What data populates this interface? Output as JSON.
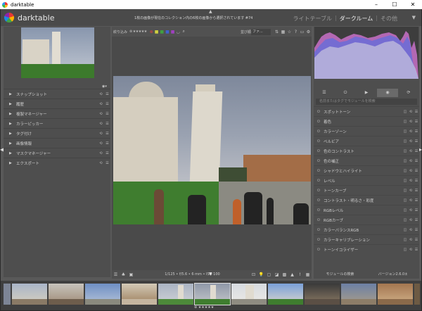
{
  "titlebar": {
    "title": "darktable",
    "min": "–",
    "max": "☐",
    "close": "✕"
  },
  "header": {
    "app_name": "darktable",
    "message": "1枚の画像が現在のコレクション内の6枚の画像から選択されています #74",
    "views": [
      "ライトテーブル",
      "ダークルーム",
      "その他"
    ],
    "active_view": "ダークルーム",
    "menu": "▼"
  },
  "left_modules": [
    "スナップショット",
    "履歴",
    "複製マネージャー",
    "カラーピッカー",
    "タグ付け",
    "画像情報",
    "マスクマネージャー",
    "エクスポート"
  ],
  "top_toolbar": {
    "filter_label": "絞り込み",
    "stars": "⊗ ★★★★★",
    "color_labels": [
      "#d64040",
      "#d0d040",
      "#40a040",
      "#4060d0",
      "#a040c0"
    ],
    "sort_label": "並び順",
    "sort_value": "ファ..."
  },
  "photo_info": "1/125 • f/5.6 • 6 mm • ISO 100",
  "right_tabs": [
    "☰",
    "⏻",
    "▶",
    "◉",
    "⟳"
  ],
  "search_placeholder": "名前またはタグでモジュールを検索",
  "right_modules": [
    "スポットトーン",
    "着色",
    "カラーゾーン",
    "ベルビア",
    "色のコントラスト",
    "色の補正",
    "シャドウとハイライト",
    "レベル",
    "トーンカーブ",
    "コントラスト・明るさ・彩度",
    "RGBレベル",
    "RGBカーブ",
    "カラーバランスRGB",
    "カラーキャリブレーション",
    "トーンイコライザー"
  ],
  "right_footer": {
    "modules_label": "モジュールの検索",
    "version": "バージョン2.6.0±"
  },
  "filmstrip": {
    "stars": "⊗ ★★★★★"
  }
}
